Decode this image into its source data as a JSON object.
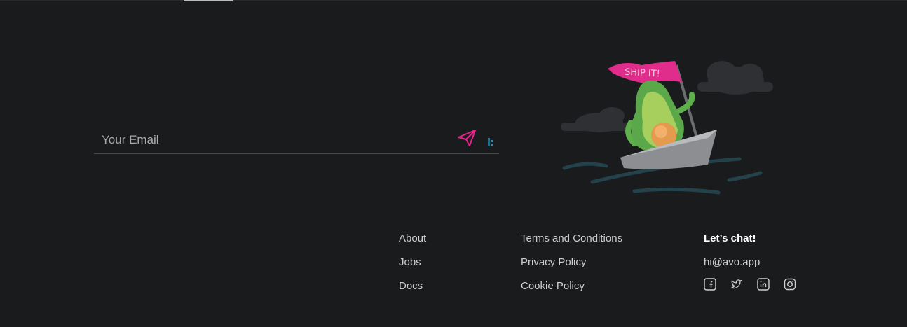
{
  "newsletter": {
    "email_placeholder": "Your Email",
    "send_icon": "paper-plane-icon"
  },
  "illustration": {
    "flag_text": "SHIP IT!",
    "description_icon": "avocado-boat-illustration"
  },
  "footer": {
    "col1": [
      {
        "label": "About"
      },
      {
        "label": "Jobs"
      },
      {
        "label": "Docs"
      }
    ],
    "col2": [
      {
        "label": "Terms and Conditions"
      },
      {
        "label": "Privacy Policy"
      },
      {
        "label": "Cookie Policy"
      }
    ],
    "contact": {
      "heading": "Let’s chat!",
      "email": "hi@avo.app",
      "social": [
        "facebook-icon",
        "twitter-icon",
        "linkedin-icon",
        "instagram-icon"
      ]
    }
  },
  "colors": {
    "background": "#1a1b1d",
    "accent": "#e6248b",
    "muted_text": "#cfcfcf"
  }
}
